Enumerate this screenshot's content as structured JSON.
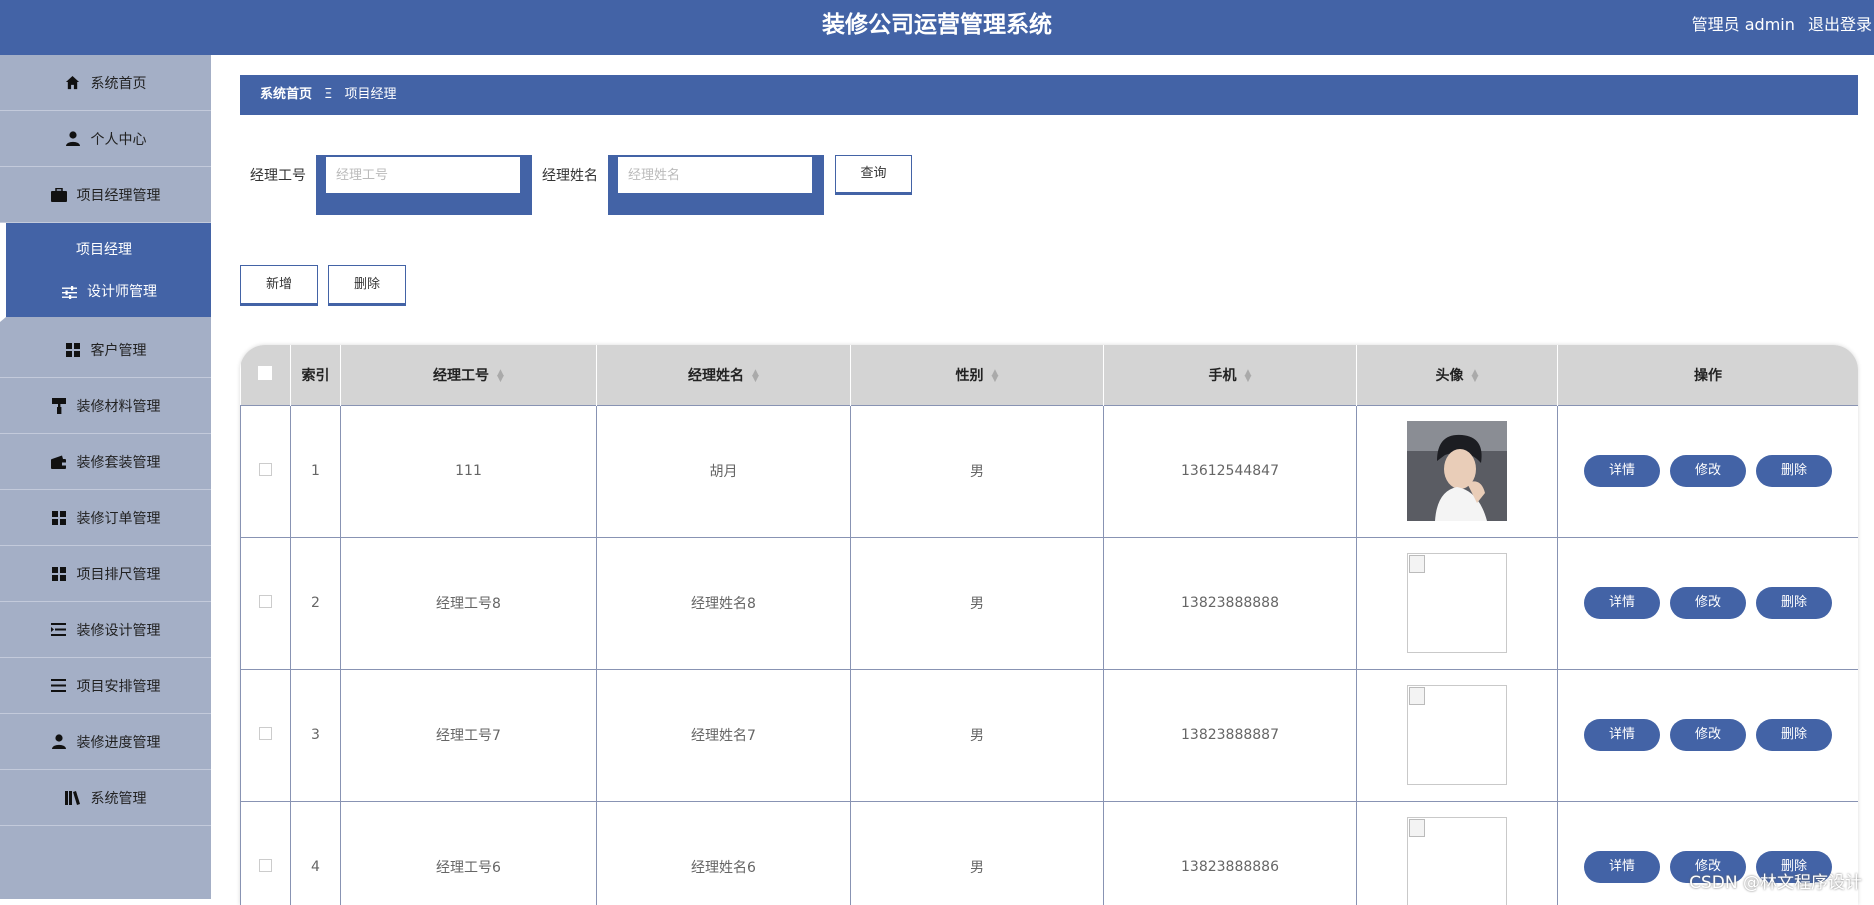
{
  "header": {
    "title": "装修公司运营管理系统",
    "user_role": "管理员 admin",
    "logout_label": "退出登录"
  },
  "sidebar": {
    "items": [
      {
        "label": "系统首页",
        "icon": "home-icon"
      },
      {
        "label": "个人中心",
        "icon": "user-icon"
      },
      {
        "label": "项目经理管理",
        "icon": "briefcase-icon"
      }
    ],
    "submenu": {
      "first": "项目经理",
      "second": "设计师管理"
    },
    "items_after": [
      {
        "label": "客户管理",
        "icon": "grid-icon"
      },
      {
        "label": "装修材料管理",
        "icon": "paint-roller-icon"
      },
      {
        "label": "装修套装管理",
        "icon": "wallet-icon"
      },
      {
        "label": "装修订单管理",
        "icon": "grid-icon"
      },
      {
        "label": "项目排尺管理",
        "icon": "grid-icon"
      },
      {
        "label": "装修设计管理",
        "icon": "list-indent-icon"
      },
      {
        "label": "项目安排管理",
        "icon": "list-icon"
      },
      {
        "label": "装修进度管理",
        "icon": "user-icon"
      },
      {
        "label": "系统管理",
        "icon": "book-icon"
      }
    ]
  },
  "breadcrumb": {
    "home": "系统首页",
    "separator": "Ξ",
    "current": "项目经理"
  },
  "search": {
    "id_label": "经理工号",
    "id_placeholder": "经理工号",
    "name_label": "经理姓名",
    "name_placeholder": "经理姓名",
    "query_button": "查询"
  },
  "actions": {
    "add": "新增",
    "delete": "删除"
  },
  "table": {
    "headers": {
      "index": "索引",
      "manager_id": "经理工号",
      "manager_name": "经理姓名",
      "gender": "性别",
      "phone": "手机",
      "avatar": "头像",
      "operation": "操作"
    },
    "row_buttons": {
      "detail": "详情",
      "edit": "修改",
      "delete": "删除"
    },
    "rows": [
      {
        "index": "1",
        "manager_id": "111",
        "manager_name": "胡月",
        "gender": "男",
        "phone": "13612544847"
      },
      {
        "index": "2",
        "manager_id": "经理工号8",
        "manager_name": "经理姓名8",
        "gender": "男",
        "phone": "13823888888"
      },
      {
        "index": "3",
        "manager_id": "经理工号7",
        "manager_name": "经理姓名7",
        "gender": "男",
        "phone": "13823888887"
      },
      {
        "index": "4",
        "manager_id": "经理工号6",
        "manager_name": "经理姓名6",
        "gender": "男",
        "phone": "13823888886"
      }
    ]
  },
  "watermark": "CSDN @林文程序设计",
  "colors": {
    "primary": "#4363a6",
    "sidebar_bg": "#a4afc6",
    "table_header_bg": "#d4d4d4"
  }
}
